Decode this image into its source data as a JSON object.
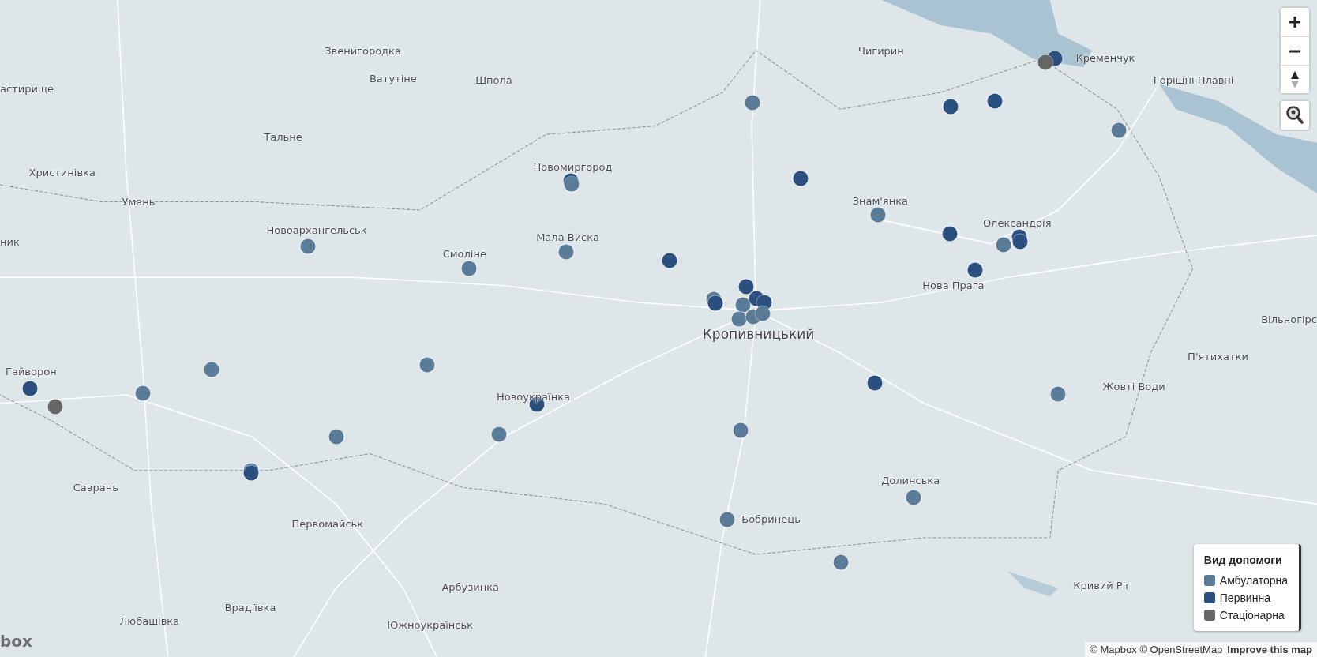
{
  "map_labels": [
    {
      "text": "Звенигородка",
      "kind": "town"
    },
    {
      "text": "Чигирин",
      "kind": "town"
    },
    {
      "text": "Кременчук",
      "kind": "town"
    },
    {
      "text": "астирище",
      "kind": "town"
    },
    {
      "text": "Ватутіне",
      "kind": "town"
    },
    {
      "text": "Шпола",
      "kind": "town"
    },
    {
      "text": "Горішні Плавні",
      "kind": "town"
    },
    {
      "text": "Тальне",
      "kind": "town"
    },
    {
      "text": "Христинівка",
      "kind": "town"
    },
    {
      "text": "Новомиргород",
      "kind": "town"
    },
    {
      "text": "Умань",
      "kind": "town"
    },
    {
      "text": "Знам'янка",
      "kind": "town"
    },
    {
      "text": "ник",
      "kind": "town"
    },
    {
      "text": "Новоархангельськ",
      "kind": "town"
    },
    {
      "text": "Олександрія",
      "kind": "town"
    },
    {
      "text": "Мала Виска",
      "kind": "town"
    },
    {
      "text": "Смоліне",
      "kind": "town"
    },
    {
      "text": "Нова Прага",
      "kind": "town"
    },
    {
      "text": "Кропивницький",
      "kind": "capital"
    },
    {
      "text": "Вільногірс",
      "kind": "town"
    },
    {
      "text": "П'ятихатки",
      "kind": "town"
    },
    {
      "text": "Гайворон",
      "kind": "town"
    },
    {
      "text": "Новоукраїнка",
      "kind": "town"
    },
    {
      "text": "Жовті Води",
      "kind": "town"
    },
    {
      "text": "Саврань",
      "kind": "town"
    },
    {
      "text": "Долинська",
      "kind": "town"
    },
    {
      "text": "Первомайськ",
      "kind": "town"
    },
    {
      "text": "Бобринець",
      "kind": "town"
    },
    {
      "text": "Арбузинка",
      "kind": "town"
    },
    {
      "text": "Кривий Ріг",
      "kind": "town"
    },
    {
      "text": "Врадіївка",
      "kind": "town"
    },
    {
      "text": "Любашівка",
      "kind": "town"
    },
    {
      "text": "Южноукраїнськ",
      "kind": "town"
    }
  ],
  "markers": [
    {
      "color": "#5b7c99"
    },
    {
      "color": "#2b5080"
    },
    {
      "color": "#2b5080"
    },
    {
      "color": "#2b5080"
    },
    {
      "color": "#666666"
    },
    {
      "color": "#5b7c99"
    },
    {
      "color": "#2b5080"
    },
    {
      "color": "#2b5080"
    },
    {
      "color": "#5b7c99"
    },
    {
      "color": "#5b7c99"
    },
    {
      "color": "#2b5080"
    },
    {
      "color": "#2b5080"
    },
    {
      "color": "#5b7c99"
    },
    {
      "color": "#2b5080"
    },
    {
      "color": "#2b5080"
    },
    {
      "color": "#5b7c99"
    },
    {
      "color": "#2b5080"
    },
    {
      "color": "#5b7c99"
    },
    {
      "color": "#5b7c99"
    },
    {
      "color": "#2b5080"
    },
    {
      "color": "#5b7c99"
    },
    {
      "color": "#2b5080"
    },
    {
      "color": "#5b7c99"
    },
    {
      "color": "#2b5080"
    },
    {
      "color": "#2b5080"
    },
    {
      "color": "#5b7c99"
    },
    {
      "color": "#5b7c99"
    },
    {
      "color": "#5b7c99"
    },
    {
      "color": "#5b7c99"
    },
    {
      "color": "#5b7c99"
    },
    {
      "color": "#2b5080"
    },
    {
      "color": "#5b7c99"
    },
    {
      "color": "#666666"
    },
    {
      "color": "#2b5080"
    },
    {
      "color": "#5b7c99"
    },
    {
      "color": "#2b5080"
    },
    {
      "color": "#5b7c99"
    },
    {
      "color": "#5b7c99"
    },
    {
      "color": "#5b7c99"
    },
    {
      "color": "#5b7c99"
    },
    {
      "color": "#2b5080"
    },
    {
      "color": "#5b7c99"
    },
    {
      "color": "#5b7c99"
    },
    {
      "color": "#5b7c99"
    }
  ],
  "legend": {
    "title": "Вид допомоги",
    "items": [
      {
        "label": "Амбулаторна",
        "color": "#5b7c99"
      },
      {
        "label": "Первинна",
        "color": "#2b5080"
      },
      {
        "label": "Стаціонарна",
        "color": "#666666"
      }
    ]
  },
  "logo_text": "box",
  "attribution": {
    "text": "© Mapbox © OpenStreetMap",
    "link": "Improve this map"
  }
}
